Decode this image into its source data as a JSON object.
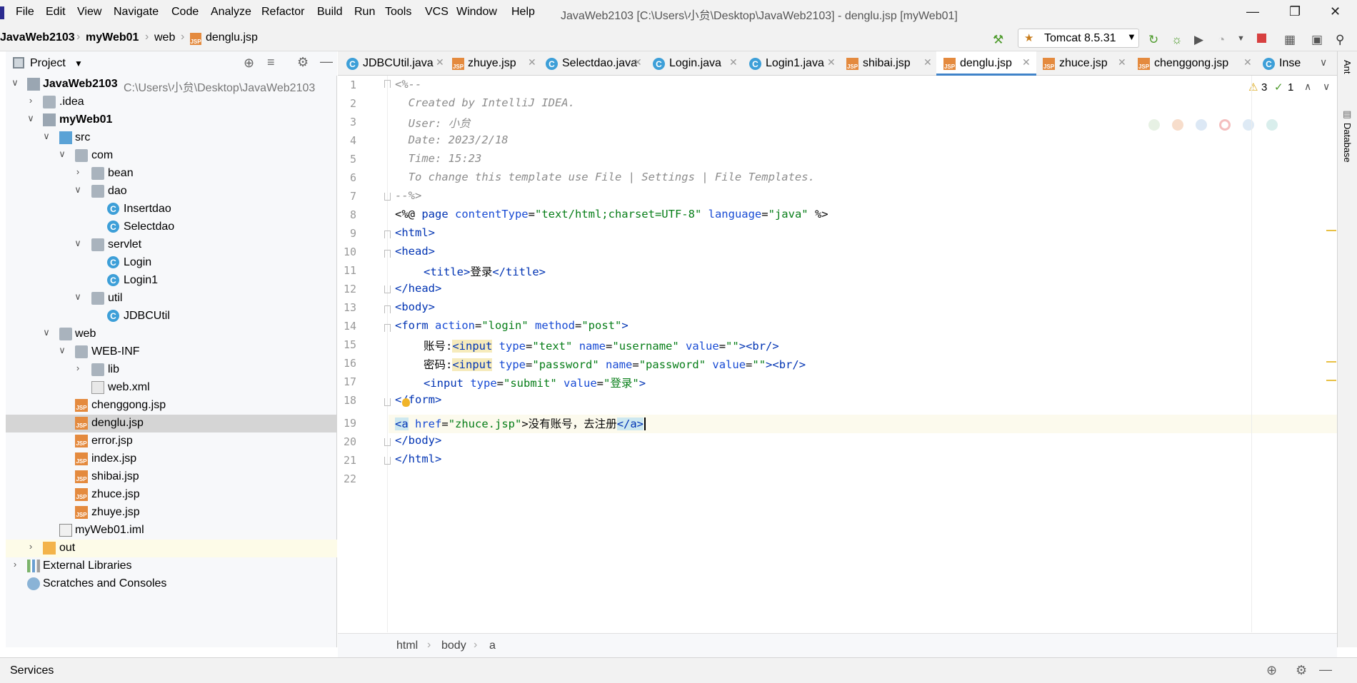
{
  "menu": {
    "items": [
      "File",
      "Edit",
      "View",
      "Navigate",
      "Code",
      "Analyze",
      "Refactor",
      "Build",
      "Run",
      "Tools",
      "VCS",
      "Window",
      "Help"
    ],
    "window_title": "JavaWeb2103 [C:\\Users\\小贠\\Desktop\\JavaWeb2103] - denglu.jsp [myWeb01]"
  },
  "breadcrumb": {
    "items": [
      "JavaWeb2103",
      "myWeb01",
      "web",
      "denglu.jsp"
    ]
  },
  "toolbar": {
    "run_config": "Tomcat 8.5.31"
  },
  "project_panel": {
    "title": "Project",
    "tree": [
      {
        "label": "JavaWeb2103",
        "path": "C:\\Users\\小贠\\Desktop\\JavaWeb2103"
      },
      {
        "label": ".idea"
      },
      {
        "label": "myWeb01"
      },
      {
        "label": "src"
      },
      {
        "label": "com"
      },
      {
        "label": "bean"
      },
      {
        "label": "dao"
      },
      {
        "label": "Insertdao"
      },
      {
        "label": "Selectdao"
      },
      {
        "label": "servlet"
      },
      {
        "label": "Login"
      },
      {
        "label": "Login1"
      },
      {
        "label": "util"
      },
      {
        "label": "JDBCUtil"
      },
      {
        "label": "web"
      },
      {
        "label": "WEB-INF"
      },
      {
        "label": "lib"
      },
      {
        "label": "web.xml"
      },
      {
        "label": "chenggong.jsp"
      },
      {
        "label": "denglu.jsp"
      },
      {
        "label": "error.jsp"
      },
      {
        "label": "index.jsp"
      },
      {
        "label": "shibai.jsp"
      },
      {
        "label": "zhuce.jsp"
      },
      {
        "label": "zhuye.jsp"
      },
      {
        "label": "myWeb01.iml"
      },
      {
        "label": "out"
      },
      {
        "label": "External Libraries"
      },
      {
        "label": "Scratches and Consoles"
      }
    ]
  },
  "tabs": [
    {
      "label": "JDBCUtil.java"
    },
    {
      "label": "zhuye.jsp"
    },
    {
      "label": "Selectdao.java"
    },
    {
      "label": "Login.java"
    },
    {
      "label": "Login1.java"
    },
    {
      "label": "shibai.jsp"
    },
    {
      "label": "denglu.jsp"
    },
    {
      "label": "zhuce.jsp"
    },
    {
      "label": "chenggong.jsp"
    },
    {
      "label": "Inse"
    }
  ],
  "editor": {
    "line_numbers": [
      "1",
      "2",
      "3",
      "4",
      "5",
      "6",
      "7",
      "8",
      "9",
      "10",
      "11",
      "12",
      "13",
      "14",
      "15",
      "16",
      "17",
      "18",
      "19",
      "20",
      "21",
      "22"
    ],
    "warnings": "3",
    "checks": "1",
    "comment_lines": [
      "<%--",
      "  Created by IntelliJ IDEA.",
      "  User: 小贠",
      "  Date: 2023/2/18",
      "  Time: 15:23",
      "  To change this template use File | Settings | File Templates.",
      "--%>"
    ],
    "line8": {
      "open": "<%@ ",
      "kw": "page",
      "a1": " contentType",
      "eq1": "=",
      "v1": "\"text/html;charset=UTF-8\"",
      "a2": " language",
      "eq2": "=",
      "v2": "\"java\"",
      "close": " %>"
    },
    "line9": "<html>",
    "line10": "<head>",
    "line11": {
      "open": "<title>",
      "text": "登录",
      "close": "</title>"
    },
    "line12": "</head>",
    "line13": "<body>",
    "line14": {
      "tag": "<form",
      "a1": " action",
      "v1": "\"login\"",
      "a2": " method",
      "v2": "\"post\"",
      "end": ">"
    },
    "line15": {
      "text": "账号:",
      "tag": "<input",
      "a1": " type",
      "v1": "\"text\"",
      "a2": " name",
      "v2": "\"username\"",
      "a3": " value",
      "v3": "\"\"",
      "end": "><br/>"
    },
    "line16": {
      "text": "密码:",
      "tag": "<input",
      "a1": " type",
      "v1": "\"password\"",
      "a2": " name",
      "v2": "\"password\"",
      "a3": " value",
      "v3": "\"\"",
      "end": "><br/>"
    },
    "line17": {
      "tag": "<input",
      "a1": " type",
      "v1": "\"submit\"",
      "a2": " value",
      "v2": "\"登录\"",
      "end": ">"
    },
    "line18": "</form>",
    "line19": {
      "tag": "<a",
      "a1": " href",
      "v1": "\"zhuce.jsp\"",
      "text": ">没有账号，去注册",
      "close": "</a>"
    },
    "line20": "</body>",
    "line21": "</html>"
  },
  "breadcrumb_bottom": [
    "html",
    "body",
    "a"
  ],
  "right_tools": [
    "Ant",
    "Database"
  ],
  "bottom": {
    "services": "Services"
  }
}
